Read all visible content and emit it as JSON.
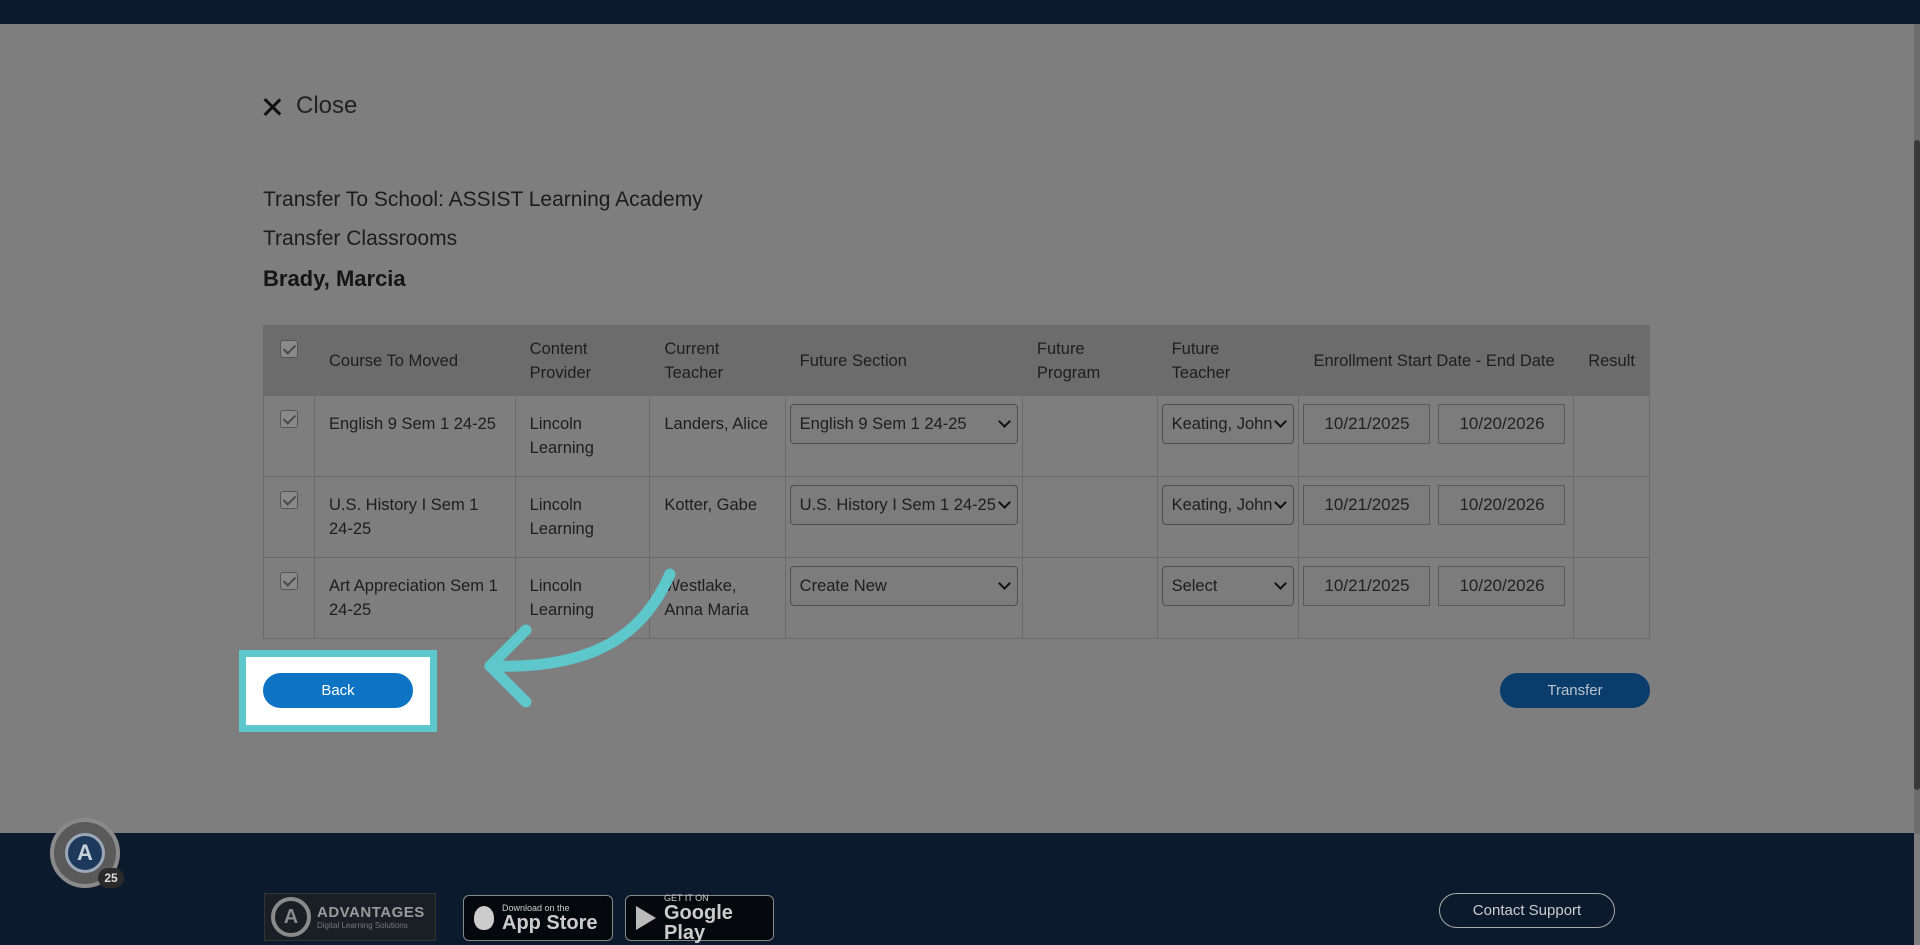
{
  "modal": {
    "close_label": "Close",
    "transfer_to": "Transfer To School: ASSIST Learning Academy",
    "section_title": "Transfer Classrooms",
    "student_name": "Brady, Marcia"
  },
  "table": {
    "headers": {
      "course": "Course To Moved",
      "provider_line1": "Content",
      "provider_line2": "Provider",
      "teacher_line1": "Current",
      "teacher_line2": "Teacher",
      "future_section": "Future Section",
      "future_program_line1": "Future",
      "future_program_line2": "Program",
      "future_teacher_line1": "Future",
      "future_teacher_line2": "Teacher",
      "dates": "Enrollment Start Date - End Date",
      "result": "Result"
    },
    "rows": [
      {
        "course": "English 9 Sem 1 24-25",
        "provider": "Lincoln Learning",
        "teacher": "Landers, Alice",
        "future_section": "English 9 Sem 1 24-25",
        "future_program": "",
        "future_teacher": "Keating, John",
        "start_date": "10/21/2025",
        "end_date": "10/20/2026",
        "result": ""
      },
      {
        "course": "U.S. History I Sem 1 24-25",
        "provider": "Lincoln Learning",
        "teacher": "Kotter, Gabe",
        "future_section": "U.S. History I Sem 1 24-25",
        "future_program": "",
        "future_teacher": "Keating, John",
        "start_date": "10/21/2025",
        "end_date": "10/20/2026",
        "result": ""
      },
      {
        "course": "Art Appreciation Sem 1 24-25",
        "provider": "Lincoln Learning",
        "teacher": "Westlake, Anna Maria",
        "future_section": "Create New",
        "future_program": "",
        "future_teacher": "Select",
        "start_date": "10/21/2025",
        "end_date": "10/20/2026",
        "result": ""
      }
    ]
  },
  "buttons": {
    "back": "Back",
    "transfer": "Transfer"
  },
  "footer": {
    "brand": "ADVANTAGES",
    "brand_tagline": "Digital Learning Solutions",
    "apple_small": "Download on the",
    "apple_big": "App Store",
    "google_small": "GET IT ON",
    "google_big": "Google Play",
    "contact_support": "Contact Support"
  },
  "badge": {
    "count": "25"
  },
  "colors": {
    "primary_button": "#0d74c4",
    "highlight": "#5ec7cb",
    "nav_dark": "#0b1a2d"
  }
}
